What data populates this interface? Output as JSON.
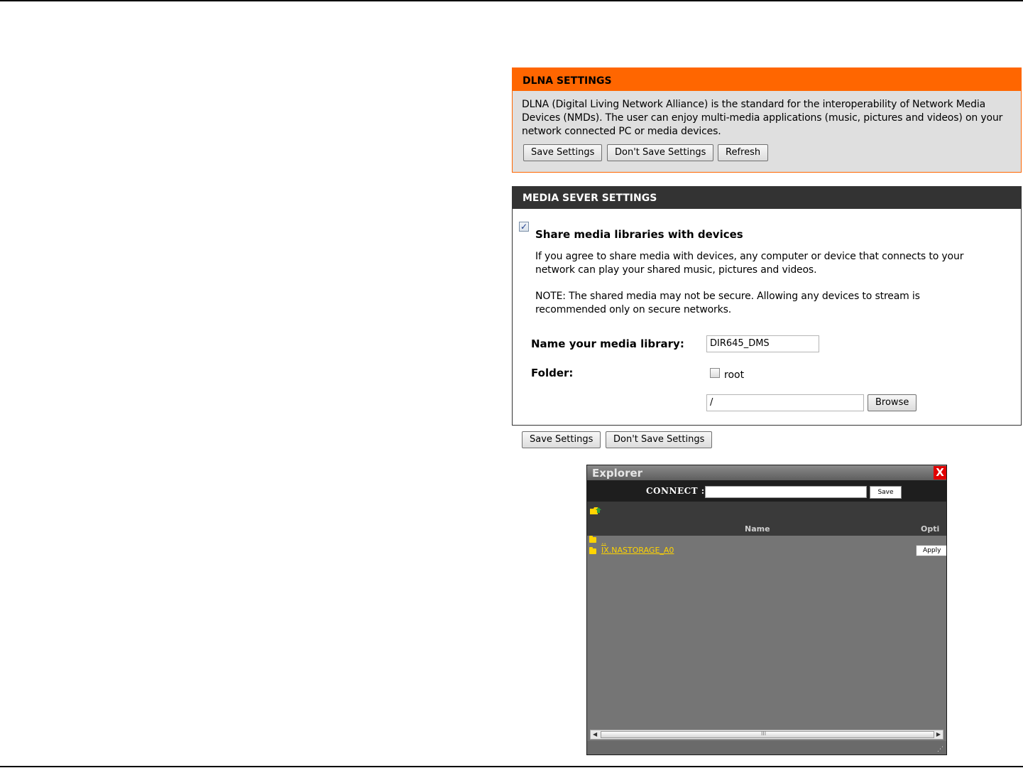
{
  "dlna": {
    "title": "DLNA SETTINGS",
    "description": "DLNA (Digital Living Network Alliance) is the standard for the interoperability of Network Media Devices (NMDs). The user can enjoy multi-media applications (music, pictures and videos) on your network connected PC or media devices.",
    "buttons": {
      "save": "Save Settings",
      "dont_save": "Don't Save Settings",
      "refresh": "Refresh"
    }
  },
  "media": {
    "title": "MEDIA SEVER SETTINGS",
    "share_checked": true,
    "share_label": "Share media libraries with devices",
    "share_text": "If you agree to share media with devices, any computer or device that connects to your network can play your shared music, pictures and videos.",
    "note_text": "NOTE: The shared media may not be secure. Allowing any devices to stream is recommended only on secure networks.",
    "library_label": "Name your media library:",
    "library_value": "DIR645_DMS",
    "folder_label": "Folder:",
    "root_label": "root",
    "root_checked": false,
    "path_value": "/",
    "browse_label": "Browse"
  },
  "bottom_buttons": {
    "save": "Save Settings",
    "dont_save": "Don't Save Settings"
  },
  "explorer": {
    "title": "Explorer",
    "close": "X",
    "connect_label": "CONNECT :",
    "connect_value": "",
    "save_label": "Save",
    "col_name": "Name",
    "col_option": "Opti",
    "items": [
      {
        "name": "..",
        "option": ""
      },
      {
        "name": "IX.NASTORAGE_A0",
        "option": "Apply"
      }
    ],
    "scroll_grip": "III"
  },
  "colors": {
    "orange": "#ff6600",
    "dark_header": "#333333",
    "explorer_bg": "#757575",
    "folder": "#ffd400",
    "close_red": "#e00000"
  }
}
